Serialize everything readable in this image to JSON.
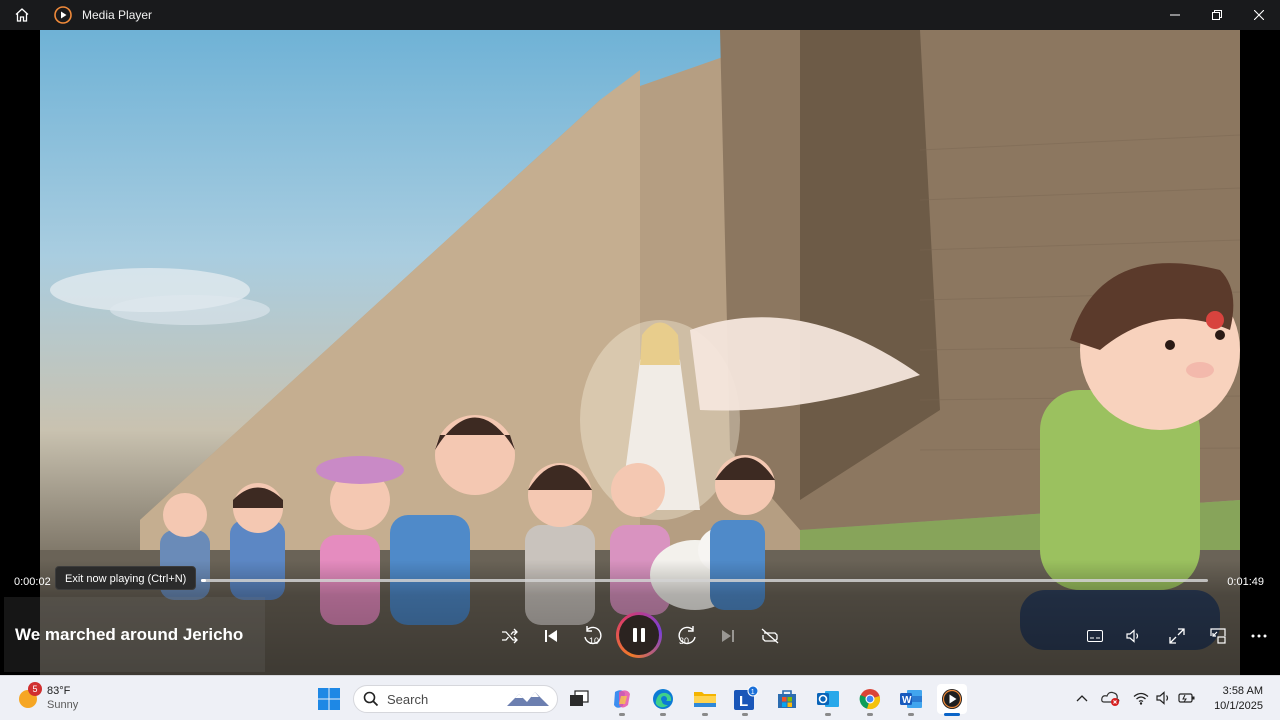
{
  "app": {
    "title": "Media Player"
  },
  "player": {
    "time_elapsed": "0:00:02",
    "time_total": "0:01:49",
    "progress_percent": 0.5,
    "tooltip": "Exit now playing (Ctrl+N)",
    "now_playing_title": "We marched around Jericho",
    "skip_back_seconds": "10",
    "skip_forward_seconds": "30",
    "accent_colors": [
      "#f07a2a",
      "#d93b6b",
      "#7a3fd6"
    ]
  },
  "taskbar": {
    "weather": {
      "temp": "83°F",
      "desc": "Sunny",
      "badge": "5"
    },
    "search": {
      "placeholder": "Search"
    },
    "apps": [
      "start-icon",
      "search-icon",
      "task-view-icon",
      "copilot-icon",
      "edge-icon",
      "file-explorer-icon",
      "l-app-icon",
      "store-icon",
      "outlook-icon",
      "chrome-icon",
      "word-icon",
      "media-player-icon"
    ],
    "l_app_badge": "1",
    "clock": {
      "time": "3:58 AM",
      "date": "10/1/2025"
    }
  }
}
